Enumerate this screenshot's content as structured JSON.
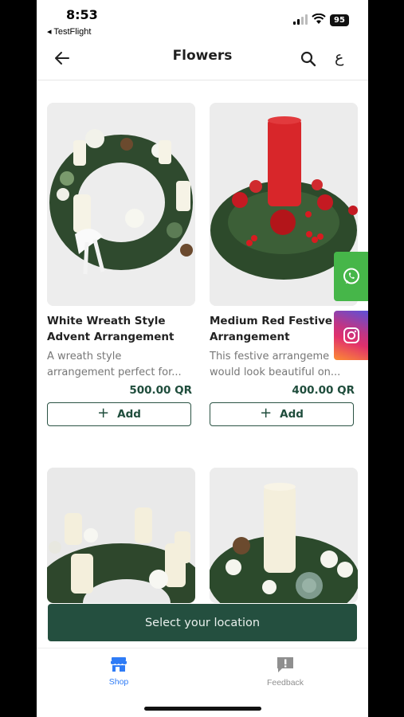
{
  "status_bar": {
    "time": "8:53",
    "back_app": "◂ TestFlight",
    "battery": "95"
  },
  "header": {
    "title": "Flowers",
    "language_toggle": "ع"
  },
  "products": [
    {
      "name_line1": "White Wreath Style",
      "name_line2": "Advent Arrangement",
      "desc_line1": "A wreath style",
      "desc_line2": "arrangement perfect for...",
      "price": "500.00 QR",
      "add_label": "Add"
    },
    {
      "name_line1": "Medium Red Festive",
      "name_line2": "Arrangement",
      "desc_line1": "This festive arrangeme",
      "desc_line2": "would look beautiful on...",
      "price": "400.00 QR",
      "add_label": "Add"
    }
  ],
  "location_bar": {
    "label": "Select your location"
  },
  "bottom_nav": {
    "shop_label": "Shop",
    "feedback_label": "Feedback"
  },
  "colors": {
    "brand_green": "#244f3f",
    "accent_blue": "#2f7cf6",
    "whatsapp": "#46b649"
  }
}
